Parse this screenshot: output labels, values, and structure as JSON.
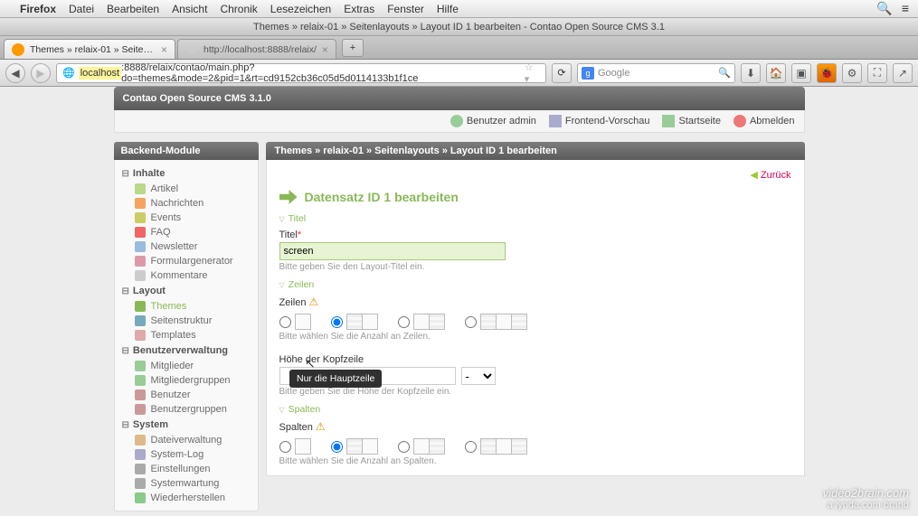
{
  "os_menu": {
    "app": "Firefox",
    "items": [
      "Datei",
      "Bearbeiten",
      "Ansicht",
      "Chronik",
      "Lesezeichen",
      "Extras",
      "Fenster",
      "Hilfe"
    ]
  },
  "window_title": "Themes » relaix-01 » Seitenlayouts » Layout ID 1 bearbeiten - Contao Open Source CMS 3.1",
  "tabs": [
    {
      "label": "Themes » relaix-01 » Seitenlay…",
      "active": true
    },
    {
      "label": "http://localhost:8888/relaix/",
      "active": false
    }
  ],
  "url": {
    "host": "localhost",
    "port_path": ":8888/relaix/contao/main.php?do=themes&mode=2&pid=1&rt=cd9152cb36c05d5d0114133b1f1ce"
  },
  "search_placeholder": "Google",
  "header_title": "Contao Open Source CMS 3.1.0",
  "top_links": {
    "user": "Benutzer admin",
    "preview": "Frontend-Vorschau",
    "home": "Startseite",
    "logout": "Abmelden"
  },
  "sidebar": {
    "title": "Backend-Module",
    "groups": [
      {
        "title": "Inhalte",
        "items": [
          {
            "label": "Artikel",
            "ic": "#b8d98a"
          },
          {
            "label": "Nachrichten",
            "ic": "#f4a460"
          },
          {
            "label": "Events",
            "ic": "#cc6"
          },
          {
            "label": "FAQ",
            "ic": "#e66"
          },
          {
            "label": "Newsletter",
            "ic": "#9bd"
          },
          {
            "label": "Formulargenerator",
            "ic": "#d9a"
          },
          {
            "label": "Kommentare",
            "ic": "#ccc"
          }
        ]
      },
      {
        "title": "Layout",
        "items": [
          {
            "label": "Themes",
            "ic": "#8ab858",
            "active": true
          },
          {
            "label": "Seitenstruktur",
            "ic": "#7ab"
          },
          {
            "label": "Templates",
            "ic": "#daa"
          }
        ]
      },
      {
        "title": "Benutzerverwaltung",
        "items": [
          {
            "label": "Mitglieder",
            "ic": "#9c9"
          },
          {
            "label": "Mitgliedergruppen",
            "ic": "#9c9"
          },
          {
            "label": "Benutzer",
            "ic": "#c99"
          },
          {
            "label": "Benutzergruppen",
            "ic": "#c99"
          }
        ]
      },
      {
        "title": "System",
        "items": [
          {
            "label": "Dateiverwaltung",
            "ic": "#db8"
          },
          {
            "label": "System-Log",
            "ic": "#aac"
          },
          {
            "label": "Einstellungen",
            "ic": "#aaa"
          },
          {
            "label": "Systemwartung",
            "ic": "#aaa"
          },
          {
            "label": "Wiederherstellen",
            "ic": "#8c8"
          }
        ]
      }
    ]
  },
  "breadcrumb": "Themes » relaix-01 » Seitenlayouts » Layout ID 1 bearbeiten",
  "back_label": "Zurück",
  "edit_heading": "Datensatz ID 1 bearbeiten",
  "sections": {
    "titel": {
      "legend": "Titel",
      "label": "Titel",
      "value": "screen",
      "help": "Bitte geben Sie den Layout-Titel ein."
    },
    "zeilen": {
      "legend": "Zeilen",
      "label": "Zeilen",
      "help": "Bitte wählen Sie die Anzahl an Zeilen.",
      "h_label": "Höhe der Kopfzeile",
      "h_unit": "-",
      "h_help": "Bitte geben Sie die Höhe der Kopfzeile ein."
    },
    "spalten": {
      "legend": "Spalten",
      "label": "Spalten",
      "help": "Bitte wählen Sie die Anzahl an Spalten."
    }
  },
  "tooltip": "Nur die Hauptzeile",
  "watermark": {
    "line1": "video2brain.com",
    "line2": "a lynda.com brand"
  }
}
